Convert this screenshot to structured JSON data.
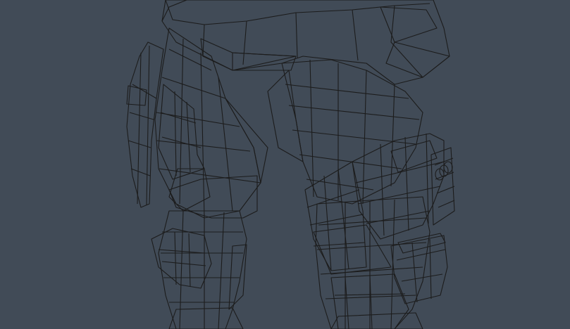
{
  "viewport": {
    "background": "#414b57",
    "render_mode": "smooth-shaded-with-wireframe",
    "subject": "armored-legs-low-poly-model",
    "mesh_color": "#c9c9c9",
    "wire_color": "#1c1c1c"
  }
}
